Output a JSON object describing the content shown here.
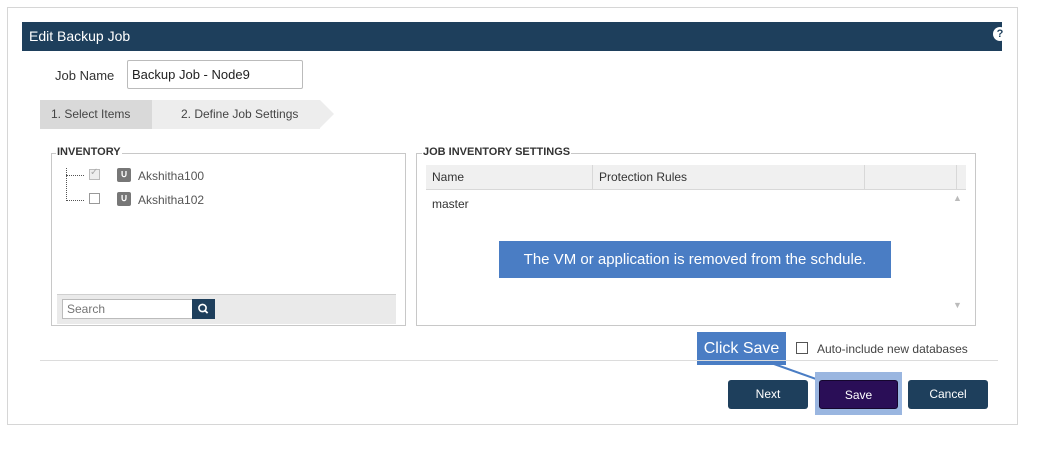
{
  "dialog": {
    "title": "Edit Backup Job",
    "help_icon": "question-circle-icon"
  },
  "job_name": {
    "label": "Job Name",
    "value": "Backup Job - Node9"
  },
  "wizard_steps": [
    {
      "label": "1. Select Items"
    },
    {
      "label": "2. Define Job Settings"
    }
  ],
  "inventory": {
    "legend": "INVENTORY",
    "items": [
      {
        "name": "Akshitha100",
        "checked": true,
        "icon": "node-icon"
      },
      {
        "name": "Akshitha102",
        "checked": false,
        "icon": "node-icon"
      }
    ],
    "search_placeholder": "Search",
    "search_icon": "magnifier-icon"
  },
  "job_inventory_settings": {
    "legend": "JOB INVENTORY SETTINGS",
    "columns": [
      "Name",
      "Protection Rules"
    ],
    "rows": [
      {
        "name": "master",
        "protection_rules": ""
      }
    ]
  },
  "annotations": {
    "removed_note": "The VM or application is removed from the schdule.",
    "click_save": "Click Save"
  },
  "options": {
    "auto_include_label": "Auto-include new databases",
    "auto_include_checked": false
  },
  "buttons": {
    "next": "Next",
    "save": "Save",
    "cancel": "Cancel"
  },
  "colors": {
    "header": "#1e3f5c",
    "callout": "#4a7dc4",
    "save_button": "#2a0e57"
  }
}
